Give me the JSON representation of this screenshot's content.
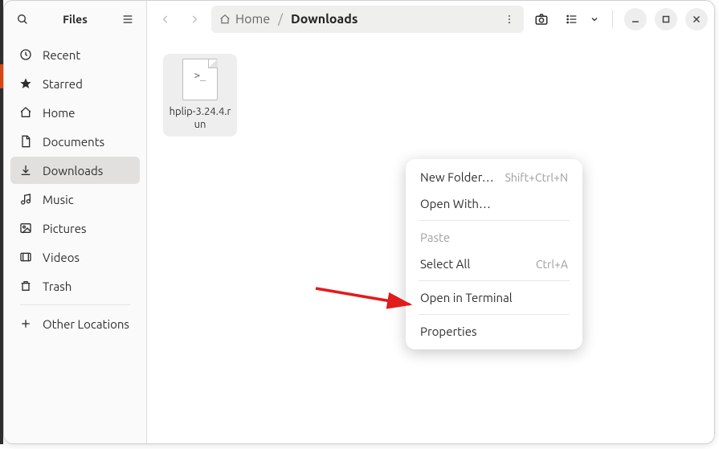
{
  "sidebar": {
    "title": "Files",
    "items": [
      {
        "label": "Recent",
        "icon": "clock"
      },
      {
        "label": "Starred",
        "icon": "star"
      },
      {
        "label": "Home",
        "icon": "home"
      },
      {
        "label": "Documents",
        "icon": "doc"
      },
      {
        "label": "Downloads",
        "icon": "download",
        "active": true
      },
      {
        "label": "Music",
        "icon": "music"
      },
      {
        "label": "Pictures",
        "icon": "picture"
      },
      {
        "label": "Videos",
        "icon": "video"
      },
      {
        "label": "Trash",
        "icon": "trash"
      }
    ],
    "other_locations": "Other Locations"
  },
  "pathbar": {
    "segments": [
      {
        "label": "Home",
        "icon": "home"
      },
      {
        "label": "Downloads"
      }
    ]
  },
  "files": [
    {
      "name": "hplip-3.24.4.run",
      "glyph": ">_",
      "selected": true
    }
  ],
  "context_menu": {
    "new_folder": {
      "label": "New Folder…",
      "shortcut": "Shift+Ctrl+N"
    },
    "open_with": {
      "label": "Open With…"
    },
    "paste": {
      "label": "Paste",
      "disabled": true
    },
    "select_all": {
      "label": "Select All",
      "shortcut": "Ctrl+A"
    },
    "open_in_terminal": {
      "label": "Open in Terminal"
    },
    "properties": {
      "label": "Properties"
    }
  }
}
